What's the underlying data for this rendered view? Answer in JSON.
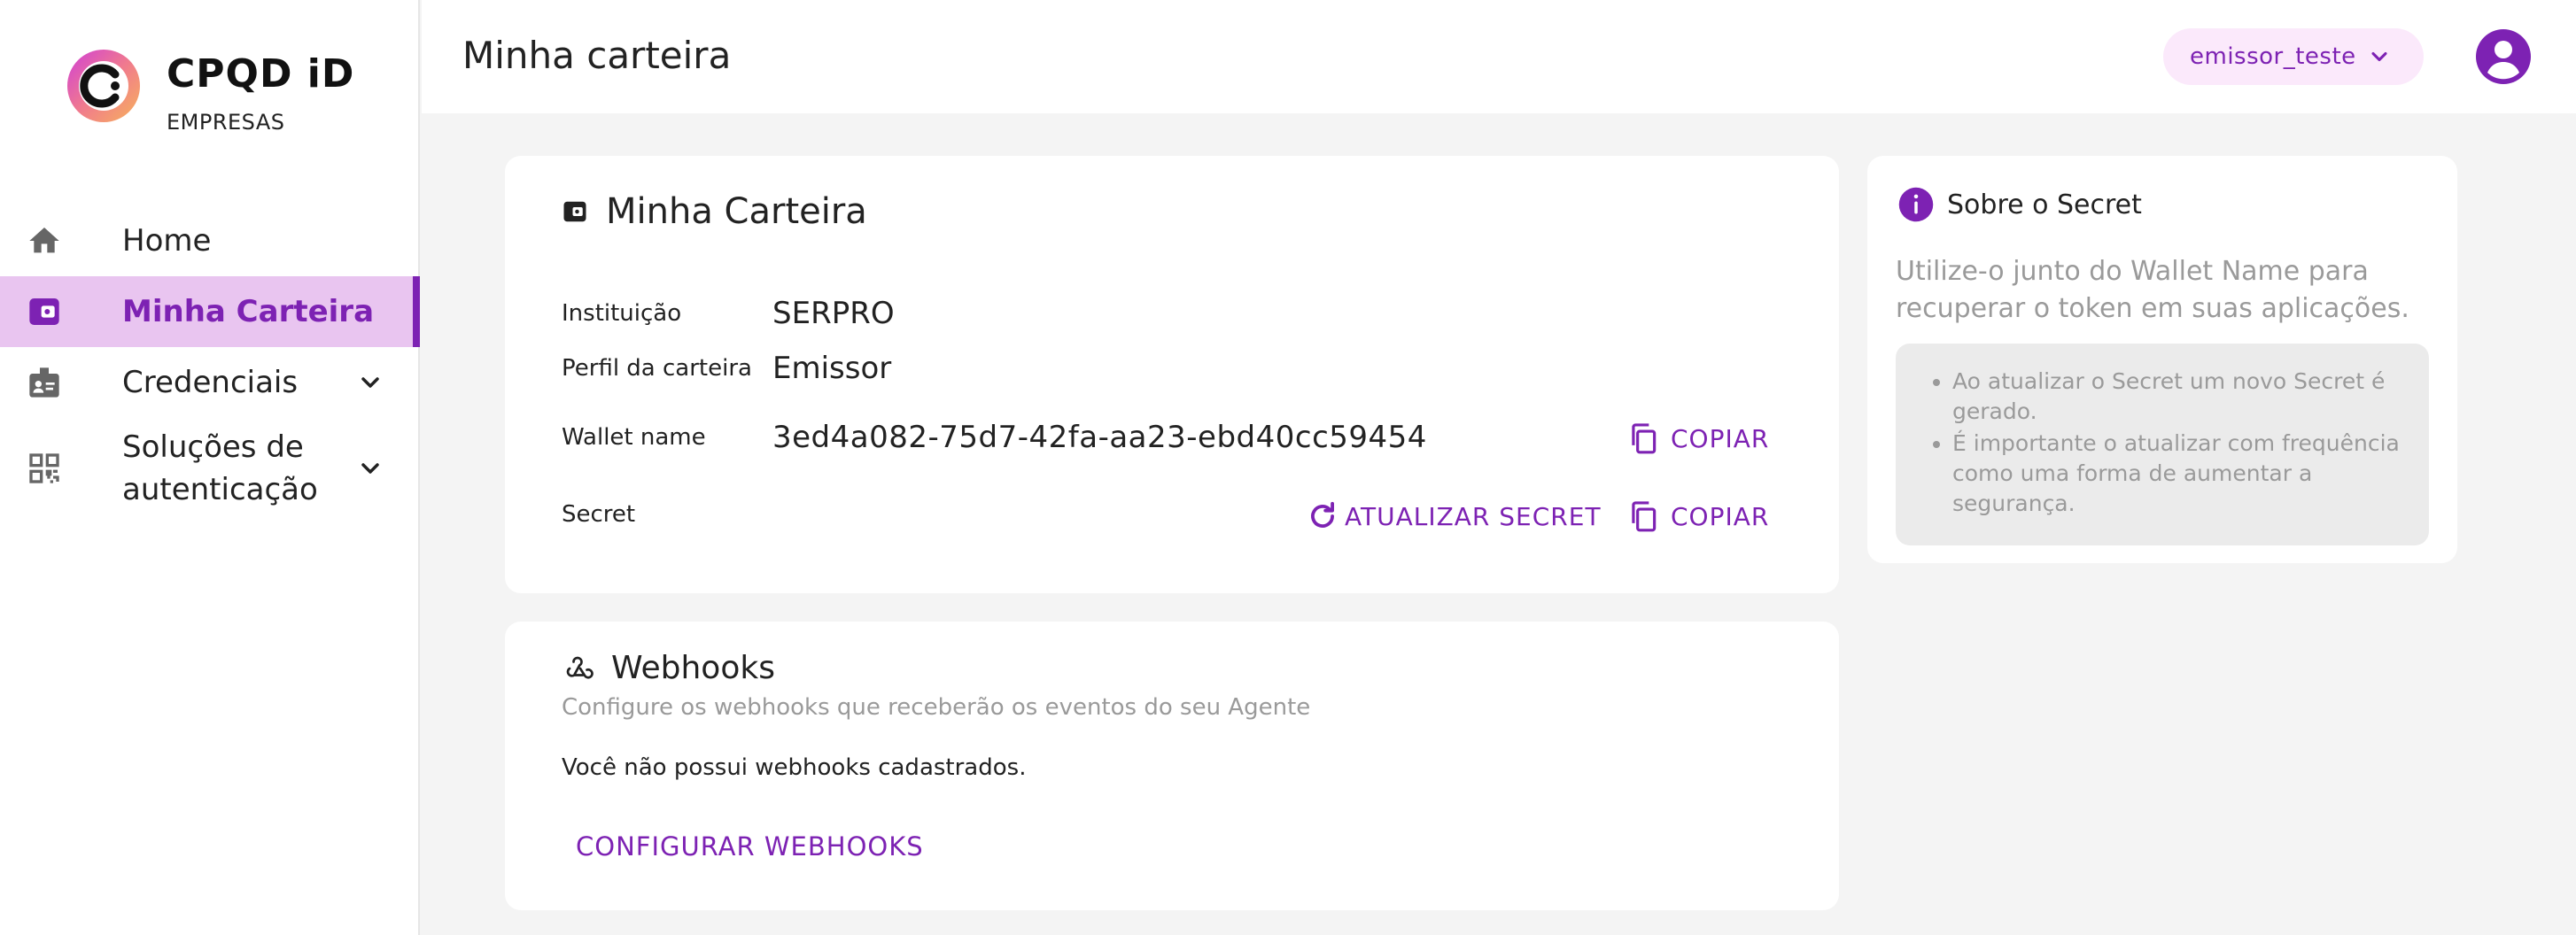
{
  "brand": {
    "name": "CPQD iD",
    "subtitle": "EMPRESAS"
  },
  "sidebar": {
    "items": [
      {
        "label": "Home",
        "icon": "home-icon"
      },
      {
        "label": "Minha Carteira",
        "icon": "wallet-icon",
        "active": true
      },
      {
        "label": "Credenciais",
        "icon": "id-card-icon",
        "expandable": true
      },
      {
        "label": "Soluções de autenticação",
        "icon": "qr-code-icon",
        "expandable": true
      }
    ]
  },
  "header": {
    "title": "Minha carteira",
    "user_select": "emissor_teste"
  },
  "wallet": {
    "title": "Minha Carteira",
    "rows": [
      {
        "label": "Instituição",
        "value": "SERPRO"
      },
      {
        "label": "Perfil da carteira",
        "value": "Emissor"
      },
      {
        "label": "Wallet name",
        "value": "3ed4a082-75d7-42fa-aa23-ebd40cc59454"
      },
      {
        "label": "Secret",
        "value": ""
      }
    ],
    "copy_label": "COPIAR",
    "refresh_label": "ATUALIZAR SECRET"
  },
  "webhooks": {
    "title": "Webhooks",
    "subtitle": "Configure os webhooks que receberão os eventos do seu Agente",
    "empty_text": "Você não possui webhooks cadastrados.",
    "button_label": "CONFIGURAR WEBHOOKS"
  },
  "secret_info": {
    "title": "Sobre o Secret",
    "description": "Utilize-o junto do Wallet Name para recuperar o token em suas aplicações.",
    "bullets": [
      "Ao atualizar o Secret um novo Secret é gerado.",
      "É importante o atualizar com frequência como uma forma de aumentar a segurança."
    ]
  },
  "colors": {
    "accent": "#7d22b3",
    "active_bg": "#e9c5f0",
    "page_bg": "#f4f4f4",
    "user_select_bg": "#fbe9fb"
  }
}
